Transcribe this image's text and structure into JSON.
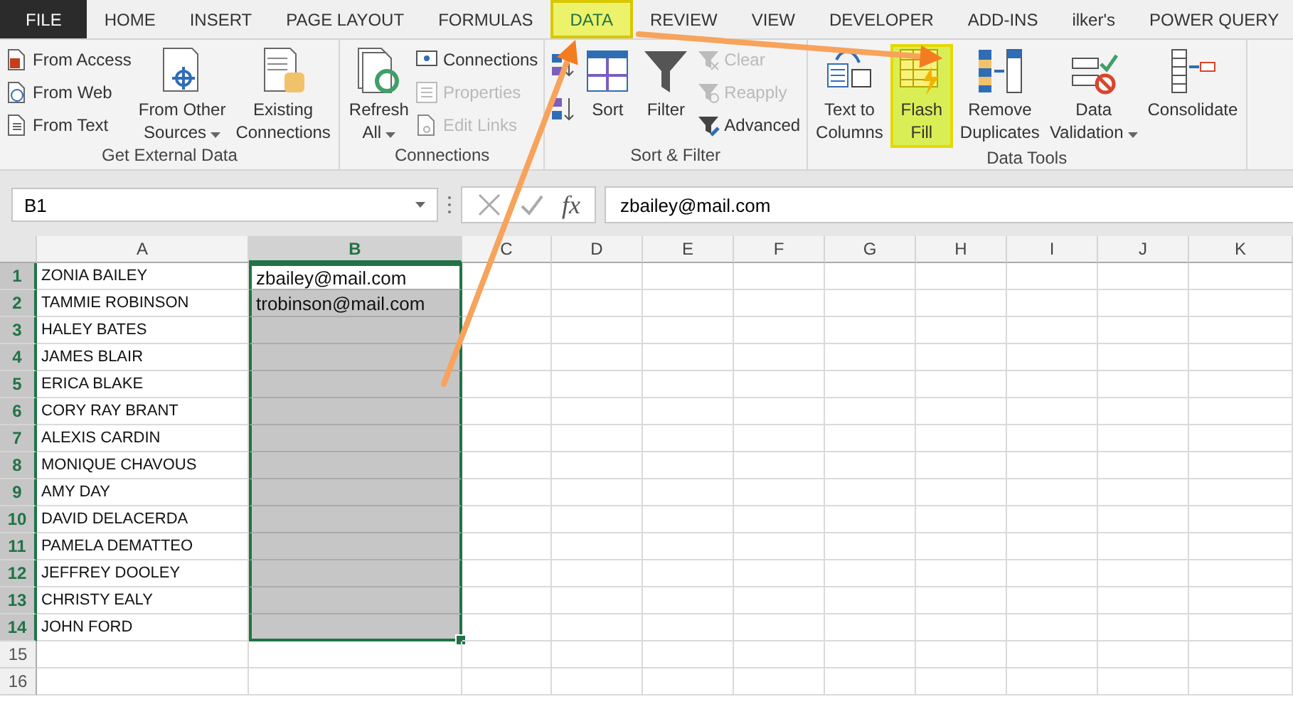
{
  "tabs": [
    {
      "label": "FILE",
      "kind": "file",
      "selected": false
    },
    {
      "label": "HOME",
      "kind": "tab",
      "selected": false
    },
    {
      "label": "INSERT",
      "kind": "tab",
      "selected": false
    },
    {
      "label": "PAGE LAYOUT",
      "kind": "tab",
      "selected": false
    },
    {
      "label": "FORMULAS",
      "kind": "tab",
      "selected": false
    },
    {
      "label": "DATA",
      "kind": "tab",
      "selected": true
    },
    {
      "label": "REVIEW",
      "kind": "tab",
      "selected": false
    },
    {
      "label": "VIEW",
      "kind": "tab",
      "selected": false
    },
    {
      "label": "DEVELOPER",
      "kind": "tab",
      "selected": false
    },
    {
      "label": "ADD-INS",
      "kind": "tab",
      "selected": false
    },
    {
      "label": "ilker's",
      "kind": "tab",
      "selected": false
    },
    {
      "label": "POWER QUERY",
      "kind": "tab",
      "selected": false
    }
  ],
  "ribbon_groups": [
    {
      "label": "Get External Data",
      "items": [
        {
          "kind": "stack",
          "items": [
            {
              "label": "From Access",
              "disabled": false
            },
            {
              "label": "From Web",
              "disabled": false
            },
            {
              "label": "From Text",
              "disabled": false
            }
          ]
        },
        {
          "kind": "large",
          "lines": [
            "From Other",
            "Sources"
          ],
          "dropdown": true,
          "highlighted": false
        },
        {
          "kind": "large",
          "lines": [
            "Existing",
            "Connections"
          ],
          "dropdown": false,
          "highlighted": false
        }
      ]
    },
    {
      "label": "Connections",
      "items": [
        {
          "kind": "large",
          "lines": [
            "Refresh",
            "All"
          ],
          "dropdown": true,
          "highlighted": false
        },
        {
          "kind": "stack",
          "items": [
            {
              "label": "Connections",
              "disabled": false
            },
            {
              "label": "Properties",
              "disabled": true
            },
            {
              "label": "Edit Links",
              "disabled": true
            }
          ]
        }
      ]
    },
    {
      "label": "Sort & Filter",
      "items": [
        {
          "kind": "sort_icons"
        },
        {
          "kind": "large",
          "lines": [
            "Sort"
          ],
          "dropdown": false,
          "highlighted": false
        },
        {
          "kind": "large",
          "lines": [
            "Filter"
          ],
          "dropdown": false,
          "highlighted": false
        },
        {
          "kind": "stack",
          "items": [
            {
              "label": "Clear",
              "disabled": true
            },
            {
              "label": "Reapply",
              "disabled": true
            },
            {
              "label": "Advanced",
              "disabled": false
            }
          ]
        }
      ]
    },
    {
      "label": "Data Tools",
      "items": [
        {
          "kind": "large",
          "lines": [
            "Text to",
            "Columns"
          ],
          "dropdown": false,
          "highlighted": false
        },
        {
          "kind": "large",
          "lines": [
            "Flash",
            "Fill"
          ],
          "dropdown": false,
          "highlighted": true
        },
        {
          "kind": "large",
          "lines": [
            "Remove",
            "Duplicates"
          ],
          "dropdown": false,
          "highlighted": false
        },
        {
          "kind": "large",
          "lines": [
            "Data",
            "Validation"
          ],
          "dropdown": true,
          "highlighted": false
        },
        {
          "kind": "large",
          "lines": [
            "Consolidate"
          ],
          "dropdown": false,
          "highlighted": false
        }
      ]
    }
  ],
  "formula_bar": {
    "name_box": "B1",
    "function_button": "fx",
    "formula": "zbailey@mail.com"
  },
  "columns": [
    {
      "label": "A",
      "selected": false
    },
    {
      "label": "B",
      "selected": true
    },
    {
      "label": "C",
      "selected": false
    },
    {
      "label": "D",
      "selected": false
    },
    {
      "label": "E",
      "selected": false
    },
    {
      "label": "F",
      "selected": false
    },
    {
      "label": "G",
      "selected": false
    },
    {
      "label": "H",
      "selected": false
    },
    {
      "label": "I",
      "selected": false
    },
    {
      "label": "J",
      "selected": false
    },
    {
      "label": "K",
      "selected": false
    }
  ],
  "rows": [
    {
      "number": "1",
      "selected": true,
      "active": true,
      "cells": [
        "ZONIA BAILEY",
        "zbailey@mail.com"
      ]
    },
    {
      "number": "2",
      "selected": true,
      "active": false,
      "cells": [
        "TAMMIE ROBINSON",
        "trobinson@mail.com"
      ]
    },
    {
      "number": "3",
      "selected": true,
      "active": false,
      "cells": [
        "HALEY BATES"
      ]
    },
    {
      "number": "4",
      "selected": true,
      "active": false,
      "cells": [
        "JAMES BLAIR"
      ]
    },
    {
      "number": "5",
      "selected": true,
      "active": false,
      "cells": [
        "ERICA BLAKE"
      ]
    },
    {
      "number": "6",
      "selected": true,
      "active": false,
      "cells": [
        "CORY RAY BRANT"
      ]
    },
    {
      "number": "7",
      "selected": true,
      "active": false,
      "cells": [
        "ALEXIS CARDIN"
      ]
    },
    {
      "number": "8",
      "selected": true,
      "active": false,
      "cells": [
        "MONIQUE CHAVOUS"
      ]
    },
    {
      "number": "9",
      "selected": true,
      "active": false,
      "cells": [
        "AMY DAY"
      ]
    },
    {
      "number": "10",
      "selected": true,
      "active": false,
      "cells": [
        "DAVID DELACERDA"
      ]
    },
    {
      "number": "11",
      "selected": true,
      "active": false,
      "cells": [
        "PAMELA DEMATTEO"
      ]
    },
    {
      "number": "12",
      "selected": true,
      "active": false,
      "cells": [
        "JEFFREY DOOLEY"
      ]
    },
    {
      "number": "13",
      "selected": true,
      "active": false,
      "cells": [
        "CHRISTY EALY"
      ]
    },
    {
      "number": "14",
      "selected": true,
      "active": false,
      "cells": [
        "JOHN FORD"
      ]
    },
    {
      "number": "15",
      "selected": false,
      "active": false,
      "cells": []
    },
    {
      "number": "16",
      "selected": false,
      "active": false,
      "cells": []
    }
  ]
}
